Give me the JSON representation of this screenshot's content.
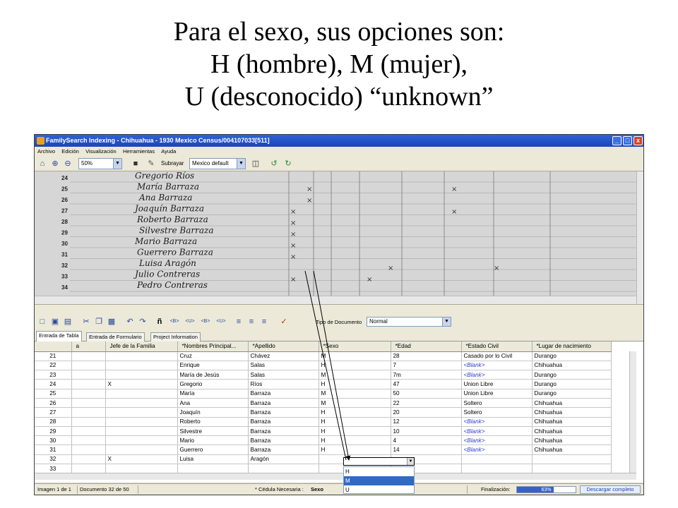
{
  "slide": {
    "title_lines": [
      "Para el sexo, sus opciones son:",
      "H (hombre), M (mujer),",
      "U (desconocido) “unknown”"
    ]
  },
  "window": {
    "title": "FamilySearch Indexing - Chihuahua - 1930 Mexico Census/004107033[511]",
    "controls": [
      "_",
      "□",
      "x"
    ]
  },
  "menu": [
    "Archivo",
    "Edición",
    "Visualización",
    "Herramientas",
    "Ayuda"
  ],
  "toolbar": {
    "zoom_value": "50%",
    "underline_label": "Subrayar",
    "underline_mode": "Mexico default",
    "doc_type_label": "Tipo de Documento",
    "doc_type_value": "Normal"
  },
  "icons": {
    "home": "home-icon",
    "zoom_in": "zoom-in-icon",
    "zoom_out": "zoom-out-icon",
    "rotate": "rotate-icon",
    "pencil": "pencil-icon",
    "split": "split-view-icon",
    "prev": "prev-image-icon",
    "next": "next-image-icon"
  },
  "toolbar2_labels": [
    "<B>",
    "<U>",
    "<B>",
    "<U>",
    "ñ"
  ],
  "tabs": [
    "Entrada de Tabla",
    "Entrada de Formulario",
    "Project Information"
  ],
  "grid": {
    "columns": [
      "",
      "a",
      "Jefe de la Familia",
      "*Nombres Principal...",
      "*Apellido",
      "*Sexo",
      "*Edad",
      "*Estado Civil",
      "*Lugar de nacimiento"
    ],
    "rows": [
      [
        "21",
        "",
        "",
        "Cruz",
        "Chávez",
        "M",
        "28",
        "Casado por lo Civil",
        "Durango"
      ],
      [
        "22",
        "",
        "",
        "Enrique",
        "Salas",
        "H",
        "7",
        "<Blank>",
        "Chihuahua"
      ],
      [
        "23",
        "",
        "",
        "María de Jesús",
        "Salas",
        "M",
        "7m",
        "<Blank>",
        "Durango"
      ],
      [
        "24",
        "",
        "X",
        "Gregorio",
        "Ríos",
        "H",
        "47",
        "Union Libre",
        "Durango"
      ],
      [
        "25",
        "",
        "",
        "María",
        "Barraza",
        "M",
        "50",
        "Union Libre",
        "Durango"
      ],
      [
        "26",
        "",
        "",
        "Ana",
        "Barraza",
        "M",
        "22",
        "Soltero",
        "Chihuahua"
      ],
      [
        "27",
        "",
        "",
        "Joaquín",
        "Barraza",
        "H",
        "20",
        "Soltero",
        "Chihuahua"
      ],
      [
        "28",
        "",
        "",
        "Roberto",
        "Barraza",
        "H",
        "12",
        "<Blank>",
        "Chihuahua"
      ],
      [
        "29",
        "",
        "",
        "Silvestre",
        "Barraza",
        "H",
        "10",
        "<Blank>",
        "Chihuahua"
      ],
      [
        "30",
        "",
        "",
        "Mario",
        "Barraza",
        "H",
        "4",
        "<Blank>",
        "Chihuahua"
      ],
      [
        "31",
        "",
        "",
        "Guerrero",
        "Barraza",
        "H",
        "14",
        "<Blank>",
        "Chihuahua"
      ],
      [
        "32",
        "",
        "X",
        "Luisa",
        "Aragón",
        "",
        "",
        "",
        ""
      ],
      [
        "33",
        "",
        "",
        "",
        "",
        "",
        "",
        "",
        ""
      ]
    ],
    "sex_options": [
      "H",
      "M",
      "U"
    ],
    "sex_selected_index": 1
  },
  "image_rows": [
    "24",
    "25",
    "26",
    "27",
    "28",
    "29",
    "30",
    "31",
    "32",
    "33",
    "34"
  ],
  "image_handwriting": [
    "Gregorio Ríos",
    "María Barraza",
    "Ana Barraza",
    "Joaquín Barraza",
    "Roberto Barraza",
    "Silvestre Barraza",
    "Mario Barraza",
    "Guerrero Barraza",
    "Luisa Aragón",
    "Julio Contreras",
    "Pedro Contreras"
  ],
  "status": {
    "image": "Imagen 1 de 1",
    "document": "Documento 32 de 50",
    "required_label": "* Cédula Necesaria :",
    "required_value": "Sexo",
    "finalization_label": "Finalización:",
    "progress_percent": 63,
    "progress_text": "63%",
    "download_label": "Descargar completo"
  },
  "colors": {
    "title_bar": "#2f62d8",
    "blank_text": "#2b3fd0",
    "selection": "#316ac5",
    "highlight": "#78c8dc"
  }
}
